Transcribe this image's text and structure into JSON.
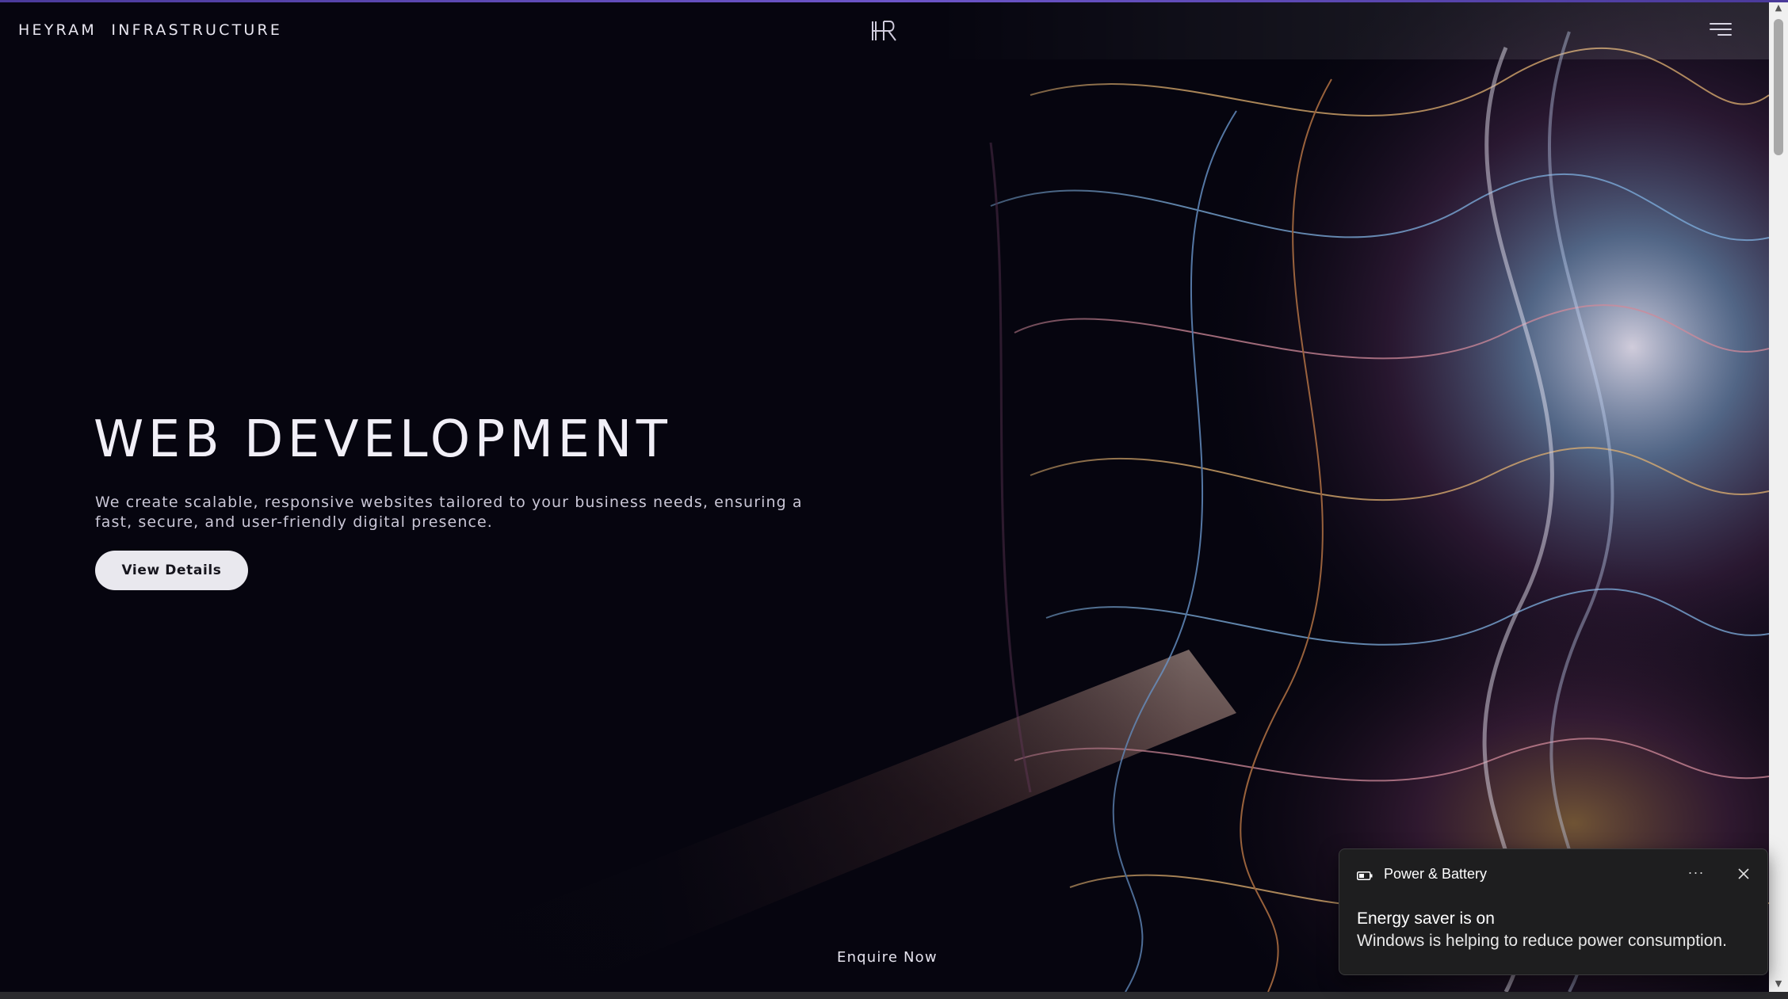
{
  "header": {
    "brand": "HEYRAM  INFRASTRUCTURE",
    "logo_text": "HR",
    "menu_icon": "hamburger-menu-icon"
  },
  "hero": {
    "title": "WEB DEVELOPMENT",
    "description": "We create scalable, responsive websites tailored to your business needs, ensuring a fast, secure, and user-friendly digital presence.",
    "cta_label": "View Details",
    "enquire_label": "Enquire Now"
  },
  "notification": {
    "app_name": "Power & Battery",
    "app_icon": "battery-icon",
    "more_label": "···",
    "title": "Energy saver is on",
    "body": "Windows is helping to reduce power consumption."
  },
  "colors": {
    "background": "#06050f",
    "accent_bar": "#6c55c8",
    "button_bg": "#e9e8ee",
    "toast_bg": "#1e1e1f"
  }
}
